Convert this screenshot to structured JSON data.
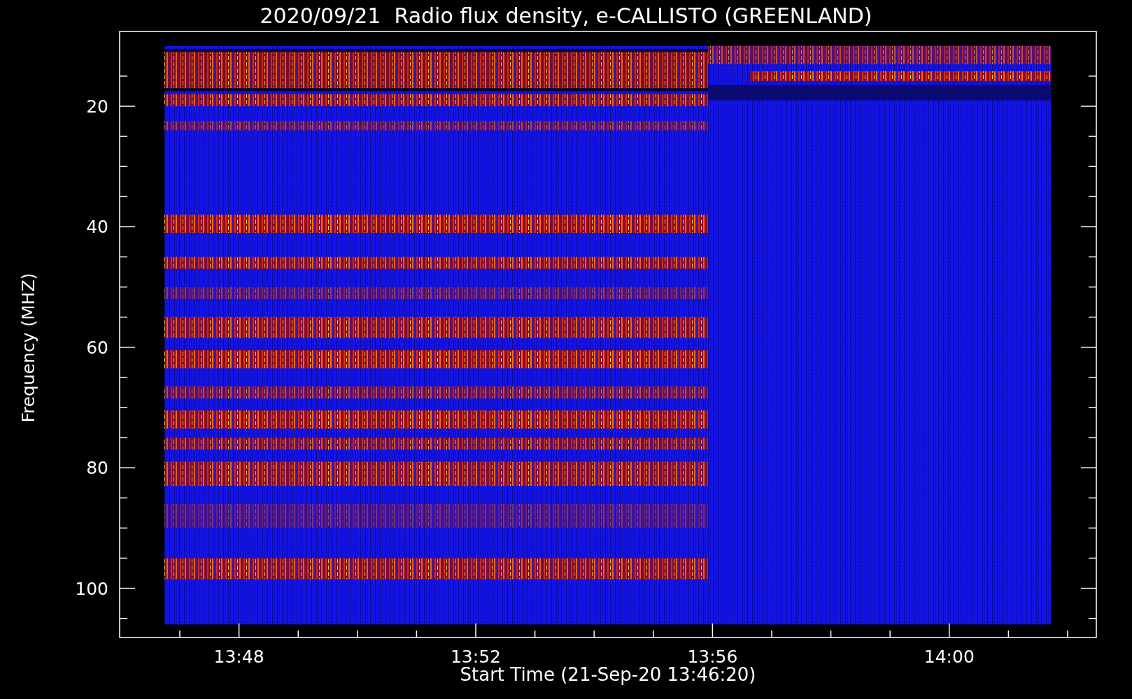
{
  "title": "2020/09/21  Radio flux density, e-CALLISTO (GREENLAND)",
  "y_axis": {
    "label": "Frequency (MHZ)",
    "ticks": [
      "20",
      "40",
      "60",
      "80",
      "100"
    ]
  },
  "x_axis": {
    "label": "Start Time (21-Sep-20 13:46:20)",
    "ticks": [
      "13:48",
      "13:52",
      "13:56",
      "14:00"
    ]
  }
}
